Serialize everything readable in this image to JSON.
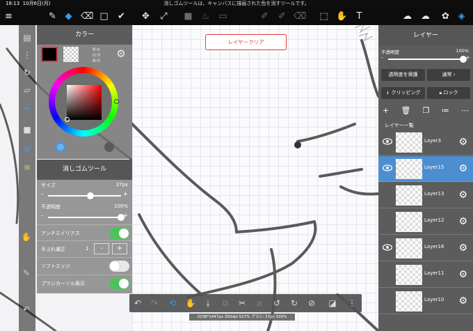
{
  "status_bar": {
    "time": "18:13",
    "date": "10月6日(月)",
    "message": "消しゴムツールは、キャンバスに描画された色を消すツールです。"
  },
  "colors": {
    "accent": "#3c9ae4",
    "selected_layer": "#4d8ed0",
    "clear_button": "#e03a3a",
    "toggle_on": "#4cc35a"
  },
  "color_panel": {
    "title": "カラー",
    "r": "R:0",
    "g": "G:0",
    "b": "B:0",
    "tab_icon": "color-tab-icon"
  },
  "tool_panel": {
    "title": "消しゴムツール",
    "size_label": "サイズ",
    "size_value": "37px",
    "size_fraction": 0.58,
    "opacity_label": "不透明度",
    "opacity_value": "100%",
    "opacity_fraction": 1.0,
    "antialias_label": "アンチエイリアス",
    "antialias_on": true,
    "stabilizer_label": "手ぶれ補正",
    "stabilizer_value": "1",
    "soft_edge_label": "ソフトエッジ",
    "soft_edge_on": false,
    "cursor_label": "ブラシカーソル表示",
    "cursor_on": true,
    "minus": "-",
    "plus": "+"
  },
  "canvas": {
    "clear_button": "レイヤークリア",
    "info": "2038*1447px 350dpi 527% ブラシ: 37px 100%"
  },
  "layer_panel": {
    "title": "レイヤー",
    "opacity_label": "不透明度",
    "opacity_value": "100%",
    "opacity_fraction": 1.0,
    "protect_alpha": "透明度を保護",
    "blend_mode": "通常",
    "clipping": "クリッピング",
    "lock": "ロック",
    "list_label": "レイヤー一覧",
    "layers": [
      {
        "name": "Layer3",
        "visible": true,
        "selected": false
      },
      {
        "name": "Layer15",
        "visible": true,
        "selected": true
      },
      {
        "name": "Layer13",
        "visible": false,
        "selected": false
      },
      {
        "name": "Layer12",
        "visible": false,
        "selected": false
      },
      {
        "name": "Layer16",
        "visible": true,
        "selected": false
      },
      {
        "name": "Layer11",
        "visible": false,
        "selected": false
      },
      {
        "name": "Layer10",
        "visible": false,
        "selected": false
      }
    ]
  }
}
